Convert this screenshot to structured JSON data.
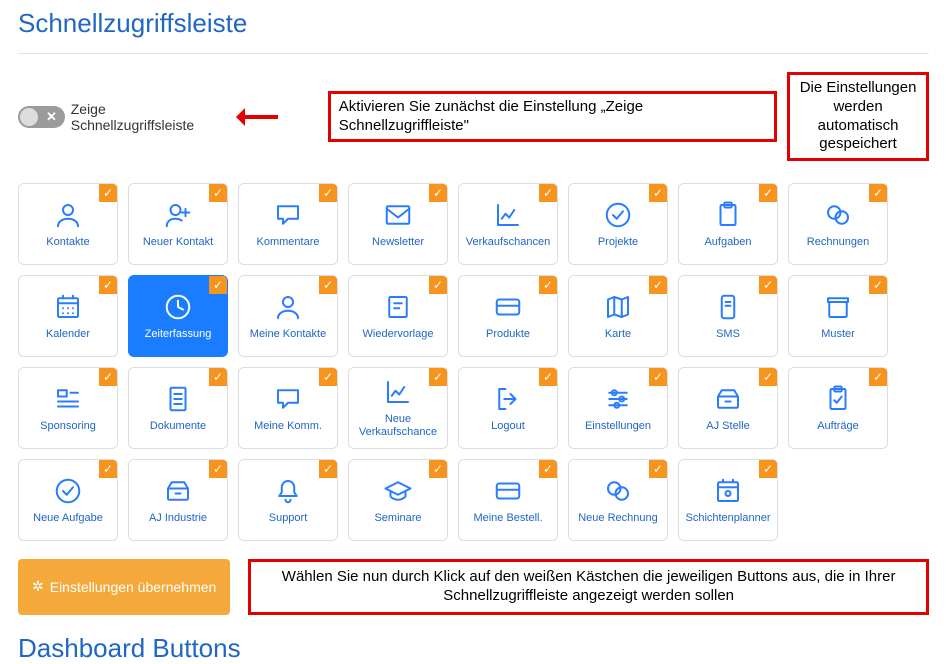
{
  "colors": {
    "accent": "#2066c4",
    "tile_icon": "#2a7cff",
    "check": "#f6941e",
    "callout_border": "#e20000",
    "apply_btn": "#f6a93b"
  },
  "section_title": "Schnellzugriffsleiste",
  "toggle": {
    "label": "Zeige Schnellzugriffsleiste",
    "on": false
  },
  "callout_activate": "Aktivieren Sie zunächst die Einstellung „Zeige Schnellzugriffleiste\"",
  "callout_autosave": "Die Einstellungen werden automatisch gespeichert",
  "callout_select": "Wählen Sie nun durch Klick auf den weißen Kästchen die jeweiligen Buttons aus, die in Ihrer Schnellzugriffleiste angezeigt werden sollen",
  "apply_button": "Einstellungen übernehmen",
  "tiles": [
    {
      "label": "Kontakte",
      "icon": "person",
      "checked": true,
      "active": false
    },
    {
      "label": "Neuer Kontakt",
      "icon": "person-plus",
      "checked": true,
      "active": false
    },
    {
      "label": "Kommentare",
      "icon": "speech",
      "checked": true,
      "active": false
    },
    {
      "label": "Newsletter",
      "icon": "mail",
      "checked": true,
      "active": false
    },
    {
      "label": "Verkaufschancen",
      "icon": "chart",
      "checked": true,
      "active": false
    },
    {
      "label": "Projekte",
      "icon": "check-circle",
      "checked": true,
      "active": false
    },
    {
      "label": "Aufgaben",
      "icon": "clipboard",
      "checked": true,
      "active": false
    },
    {
      "label": "Rechnungen",
      "icon": "coins",
      "checked": true,
      "active": false
    },
    {
      "label": "Kalender",
      "icon": "calendar-grid",
      "checked": true,
      "active": false
    },
    {
      "label": "Zeiterfassung",
      "icon": "clock",
      "checked": true,
      "active": true
    },
    {
      "label": "Meine Kontakte",
      "icon": "person",
      "checked": true,
      "active": false
    },
    {
      "label": "Wiedervorlage",
      "icon": "note",
      "checked": true,
      "active": false
    },
    {
      "label": "Produkte",
      "icon": "card",
      "checked": true,
      "active": false
    },
    {
      "label": "Karte",
      "icon": "map",
      "checked": true,
      "active": false
    },
    {
      "label": "SMS",
      "icon": "phone-msg",
      "checked": true,
      "active": false
    },
    {
      "label": "Muster",
      "icon": "box",
      "checked": true,
      "active": false
    },
    {
      "label": "Sponsoring",
      "icon": "list-lines",
      "checked": true,
      "active": false
    },
    {
      "label": "Dokumente",
      "icon": "doc-lines",
      "checked": true,
      "active": false
    },
    {
      "label": "Meine Komm.",
      "icon": "speech",
      "checked": true,
      "active": false
    },
    {
      "label": "Neue Verkaufschance",
      "icon": "chart",
      "checked": true,
      "active": false
    },
    {
      "label": "Logout",
      "icon": "logout",
      "checked": true,
      "active": false
    },
    {
      "label": "Einstellungen",
      "icon": "sliders",
      "checked": true,
      "active": false
    },
    {
      "label": "AJ Stelle",
      "icon": "drawer",
      "checked": true,
      "active": false
    },
    {
      "label": "Aufträge",
      "icon": "clipboard-check",
      "checked": true,
      "active": false
    },
    {
      "label": "Neue Aufgabe",
      "icon": "check-circle",
      "checked": true,
      "active": false
    },
    {
      "label": "AJ Industrie",
      "icon": "drawer",
      "checked": true,
      "active": false
    },
    {
      "label": "Support",
      "icon": "bell",
      "checked": true,
      "active": false
    },
    {
      "label": "Seminare",
      "icon": "grad-cap",
      "checked": true,
      "active": false
    },
    {
      "label": "Meine Bestell.",
      "icon": "card",
      "checked": true,
      "active": false
    },
    {
      "label": "Neue Rechnung",
      "icon": "coins",
      "checked": true,
      "active": false
    },
    {
      "label": "Schichtenplanner",
      "icon": "calendar-dot",
      "checked": true,
      "active": false
    }
  ],
  "section_title2": "Dashboard Buttons"
}
